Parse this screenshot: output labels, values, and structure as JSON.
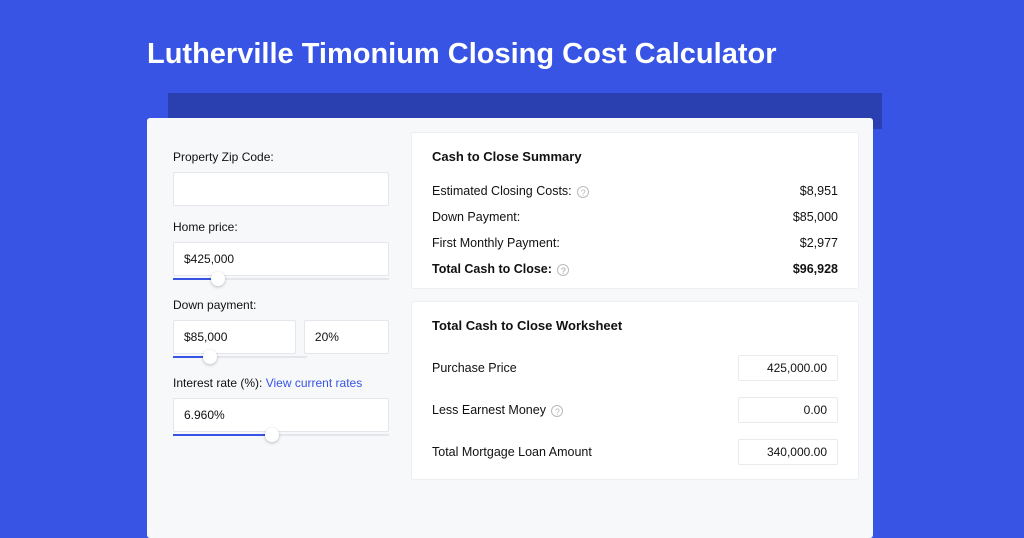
{
  "title": "Lutherville Timonium Closing Cost Calculator",
  "left": {
    "zip": {
      "label": "Property Zip Code:",
      "value": ""
    },
    "home_price": {
      "label": "Home price:",
      "value": "$425,000"
    },
    "down_payment": {
      "label": "Down payment:",
      "value": "$85,000",
      "pct": "20%"
    },
    "interest": {
      "label": "Interest rate (%):",
      "link": "View current rates",
      "value": "6.960%"
    }
  },
  "summary": {
    "heading": "Cash to Close Summary",
    "rows": [
      {
        "label": "Estimated Closing Costs:",
        "help": true,
        "value": "$8,951"
      },
      {
        "label": "Down Payment:",
        "value": "$85,000"
      },
      {
        "label": "First Monthly Payment:",
        "value": "$2,977"
      }
    ],
    "total": {
      "label": "Total Cash to Close:",
      "help": true,
      "value": "$96,928"
    }
  },
  "worksheet": {
    "heading": "Total Cash to Close Worksheet",
    "rows": [
      {
        "label": "Purchase Price",
        "value": "425,000.00"
      },
      {
        "label": "Less Earnest Money",
        "help": true,
        "value": "0.00"
      },
      {
        "label": "Total Mortgage Loan Amount",
        "value": "340,000.00"
      }
    ]
  },
  "slider_positions": {
    "home_fill_pct": 21,
    "down_fill_pct": 28,
    "rate_fill_pct": 46
  }
}
